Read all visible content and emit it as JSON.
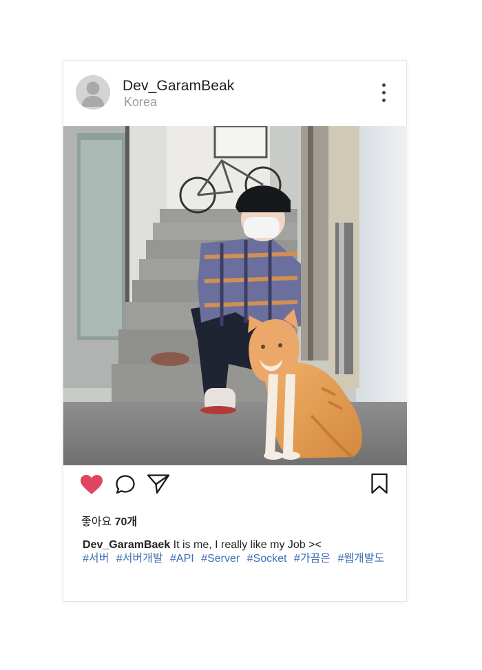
{
  "post": {
    "username": "Dev_GaramBeak",
    "location": "Korea",
    "likes_label": "좋아요",
    "likes_count": "70개",
    "caption_user": "Dev_GaramBaek",
    "caption_text": "It is me, I really like my Job ><",
    "hashtags": [
      "#서버",
      "#서버개발",
      "#API",
      "#Server",
      "#Socket",
      "#가끔은",
      "#웹개발도"
    ]
  },
  "icons": {
    "more": "more-vertical-icon",
    "like": "heart-icon",
    "comment": "comment-icon",
    "share": "send-icon",
    "save": "bookmark-icon"
  },
  "colors": {
    "like_active": "#e0455f",
    "hashtag": "#3d6fb6",
    "location": "#9a9a9a"
  }
}
